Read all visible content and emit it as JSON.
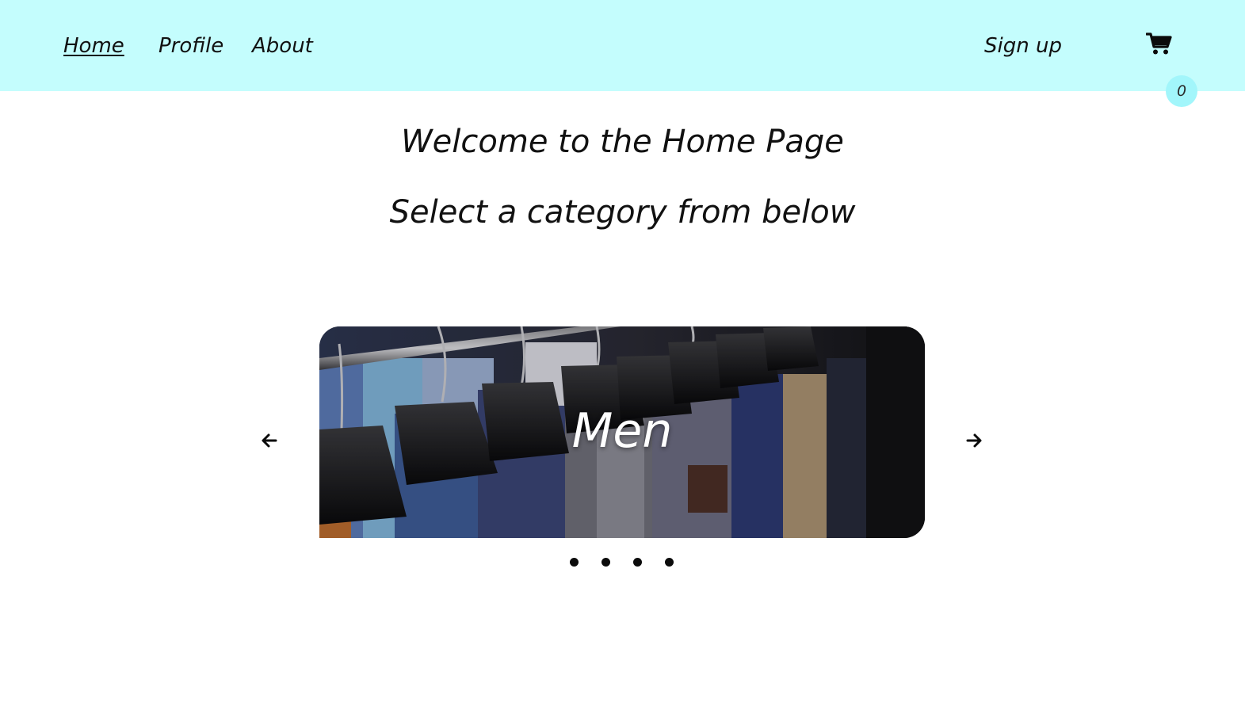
{
  "nav": {
    "home": "Home",
    "profile": "Profile",
    "about": "About",
    "signup": "Sign up",
    "cart_icon": "shopping-cart-icon",
    "cart_count": "0",
    "active": "Home"
  },
  "main": {
    "welcome": "Welcome to the Home Page",
    "prompt": "Select a category from below"
  },
  "carousel": {
    "prev_icon": "arrow-left-icon",
    "next_icon": "arrow-right-icon",
    "current_slide": {
      "label": "Men",
      "image": "suits-on-hangers-photo"
    },
    "slide_count": 4,
    "active_index": 0
  },
  "colors": {
    "navbar_bg": "#c4fdfd",
    "badge_bg": "#a2f6fb",
    "text": "#111111"
  }
}
